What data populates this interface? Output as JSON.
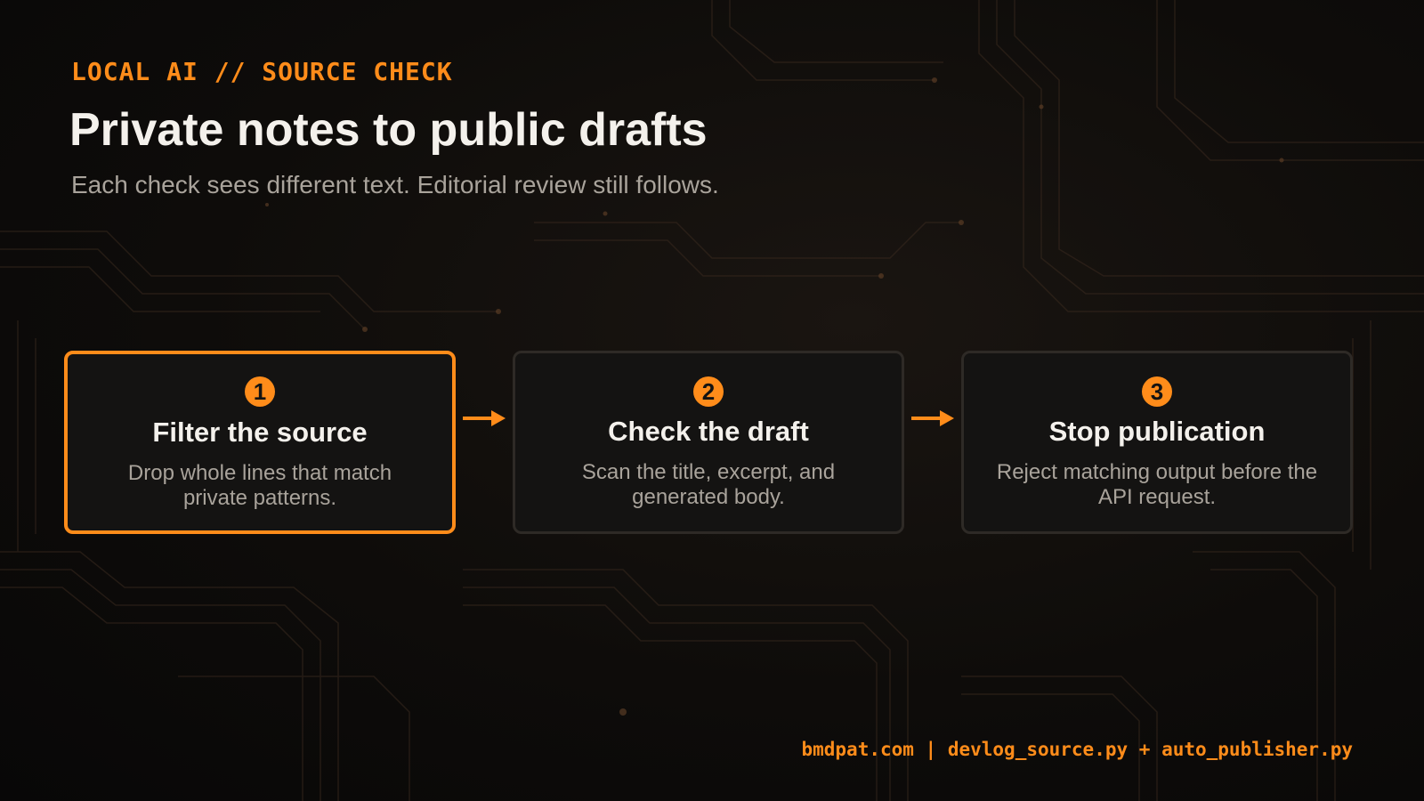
{
  "header": {
    "kicker": "LOCAL AI // SOURCE CHECK",
    "title": "Private notes to public drafts",
    "subtitle": "Each check sees different text. Editorial review still follows."
  },
  "steps": [
    {
      "number": "1",
      "title": "Filter the source",
      "description": "Drop whole lines that match private patterns.",
      "active": true
    },
    {
      "number": "2",
      "title": "Check the draft",
      "description": "Scan the title, excerpt, and generated body.",
      "active": false
    },
    {
      "number": "3",
      "title": "Stop publication",
      "description": "Reject matching output before the API request.",
      "active": false
    }
  ],
  "footer": {
    "text": "bmdpat.com | devlog_source.py + auto_publisher.py"
  },
  "colors": {
    "accent": "#ff8c1a",
    "background": "#0e0c0a",
    "card": "#141312",
    "text": "#f4f1ec",
    "muted": "#a9a39b"
  }
}
